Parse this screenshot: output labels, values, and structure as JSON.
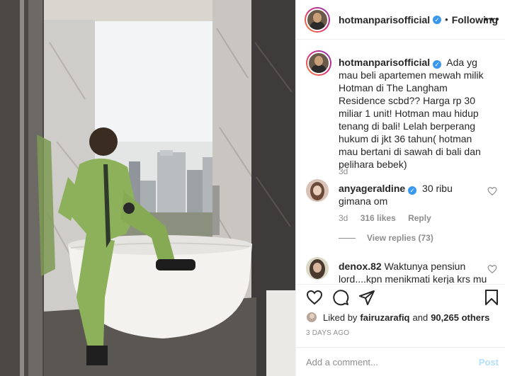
{
  "post_header": {
    "username": "hotmanparisofficial",
    "separator": "•",
    "follow_status": "Following"
  },
  "caption": {
    "username": "hotmanparisofficial",
    "text": "Ada yg mau beli apartemen mewah milik Hotman di The Langham Residence scbd?? Harga rp 30 miliar 1 unit! Hotman mau hidup tenang di bali! Lelah berperang hukum di jkt 36 tahun( hotman mau bertani di sawah di bali dan pelihara bebek)",
    "age": "3d"
  },
  "comments": [
    {
      "username": "anyageraldine",
      "text": "30 ribu gimana om",
      "age": "3d",
      "likes": "316 likes",
      "reply_label": "Reply",
      "view_replies": "View replies (73)"
    },
    {
      "username": "denox.82",
      "text": "Waktunya pensiun lord....kpn menikmati kerja krs mu"
    }
  ],
  "likes": {
    "prefix": "Liked by",
    "user": "fairuzarafiq",
    "conjunction": "and",
    "count": "90,265 others"
  },
  "timestamp": "3 DAYS AGO",
  "add_comment": {
    "placeholder": "Add a comment...",
    "post_label": "Post"
  },
  "colors": {
    "verified": "#3897f0",
    "muted": "#8e8e8e",
    "post_disabled": "#b2dffc",
    "suit_green": "#8db05a"
  },
  "icons": [
    "more-icon",
    "heart-icon",
    "comment-icon",
    "share-icon",
    "bookmark-icon",
    "verified-icon"
  ]
}
